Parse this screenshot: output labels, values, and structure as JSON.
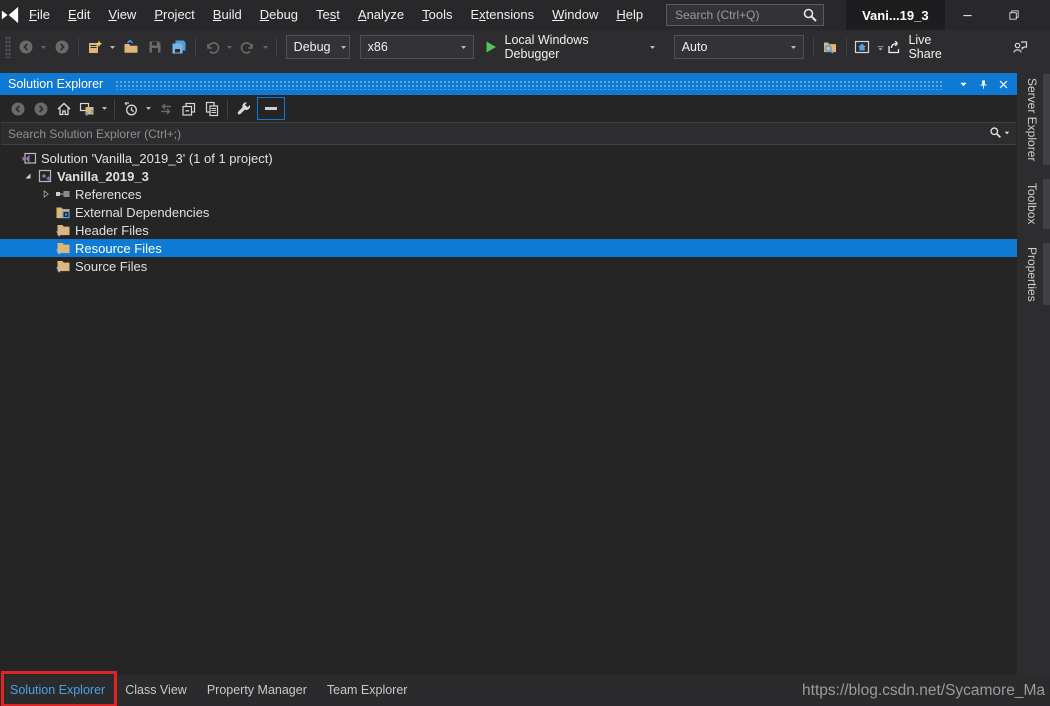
{
  "titlebar": {
    "menu_items": [
      {
        "label": "File",
        "u": 0
      },
      {
        "label": "Edit",
        "u": 0
      },
      {
        "label": "View",
        "u": 0
      },
      {
        "label": "Project",
        "u": 0
      },
      {
        "label": "Build",
        "u": 0
      },
      {
        "label": "Debug",
        "u": 0
      },
      {
        "label": "Test",
        "u": 2
      },
      {
        "label": "Analyze",
        "u": 0
      },
      {
        "label": "Tools",
        "u": 0
      },
      {
        "label": "Extensions",
        "u": 1
      },
      {
        "label": "Window",
        "u": 0
      },
      {
        "label": "Help",
        "u": 0
      }
    ],
    "search_placeholder": "Search (Ctrl+Q)",
    "window_title": "Vani...19_3"
  },
  "toolbar": {
    "config_value": "Debug",
    "platform_value": "x86",
    "run_label": "Local Windows Debugger",
    "attach_value": "Auto",
    "live_share_label": "Live Share"
  },
  "solution_explorer": {
    "title": "Solution Explorer",
    "search_placeholder": "Search Solution Explorer (Ctrl+;)",
    "tree": [
      {
        "label": "Solution 'Vanilla_2019_3' (1 of 1 project)",
        "icon": "solution",
        "indent": 20,
        "arrow": "none",
        "bold": false,
        "selected": false
      },
      {
        "label": "Vanilla_2019_3",
        "icon": "cpp-project",
        "indent": 20,
        "arrow": "expanded",
        "bold": true,
        "selected": false
      },
      {
        "label": "References",
        "icon": "references",
        "indent": 38,
        "arrow": "collapsed",
        "bold": false,
        "selected": false
      },
      {
        "label": "External Dependencies",
        "icon": "external-deps",
        "indent": 38,
        "arrow": "blank",
        "bold": false,
        "selected": false
      },
      {
        "label": "Header Files",
        "icon": "filter-folder",
        "indent": 38,
        "arrow": "blank",
        "bold": false,
        "selected": false
      },
      {
        "label": "Resource Files",
        "icon": "filter-folder",
        "indent": 38,
        "arrow": "blank",
        "bold": false,
        "selected": true
      },
      {
        "label": "Source Files",
        "icon": "filter-folder",
        "indent": 38,
        "arrow": "blank",
        "bold": false,
        "selected": false
      }
    ]
  },
  "side_tabs": [
    "Server Explorer",
    "Toolbox",
    "Properties"
  ],
  "bottom_tabs": [
    {
      "label": "Solution Explorer",
      "active": true,
      "annotated": true
    },
    {
      "label": "Class View",
      "active": false,
      "annotated": false
    },
    {
      "label": "Property Manager",
      "active": false,
      "annotated": false
    },
    {
      "label": "Team Explorer",
      "active": false,
      "annotated": false
    }
  ],
  "watermark": "https://blog.csdn.net/Sycamore_Ma",
  "colors": {
    "accent_blue": "#0e7ad3",
    "annotation_red": "#e02424",
    "folder_tan": "#dcb67a",
    "run_green": "#52c452",
    "active_tab_blue": "#4aa0e6"
  }
}
